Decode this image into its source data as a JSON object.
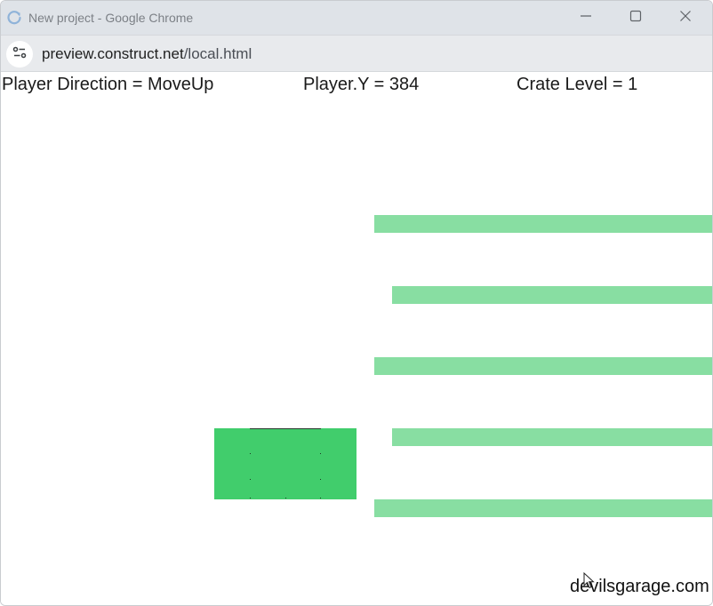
{
  "window": {
    "title": "New project - Google Chrome",
    "icons": {
      "app": "chrome-reload-icon",
      "minimize": "minimize-icon",
      "maximize": "maximize-icon",
      "close": "close-icon"
    }
  },
  "address_bar": {
    "site_info_icon": "site-settings-icon",
    "url_host": "preview.construct.net",
    "url_path": "/local.html"
  },
  "game": {
    "hud": {
      "player_direction": "Player Direction = MoveUp",
      "player_y": "Player.Y = 384",
      "crate_level": "Crate Level = 1"
    },
    "colors": {
      "platform": "#88dea2",
      "player": "#41cd6c",
      "background": "#ffffff"
    },
    "platform_count": 5,
    "watermark": "devilsgarage.com",
    "cursor_icon": "mouse-pointer-icon"
  }
}
